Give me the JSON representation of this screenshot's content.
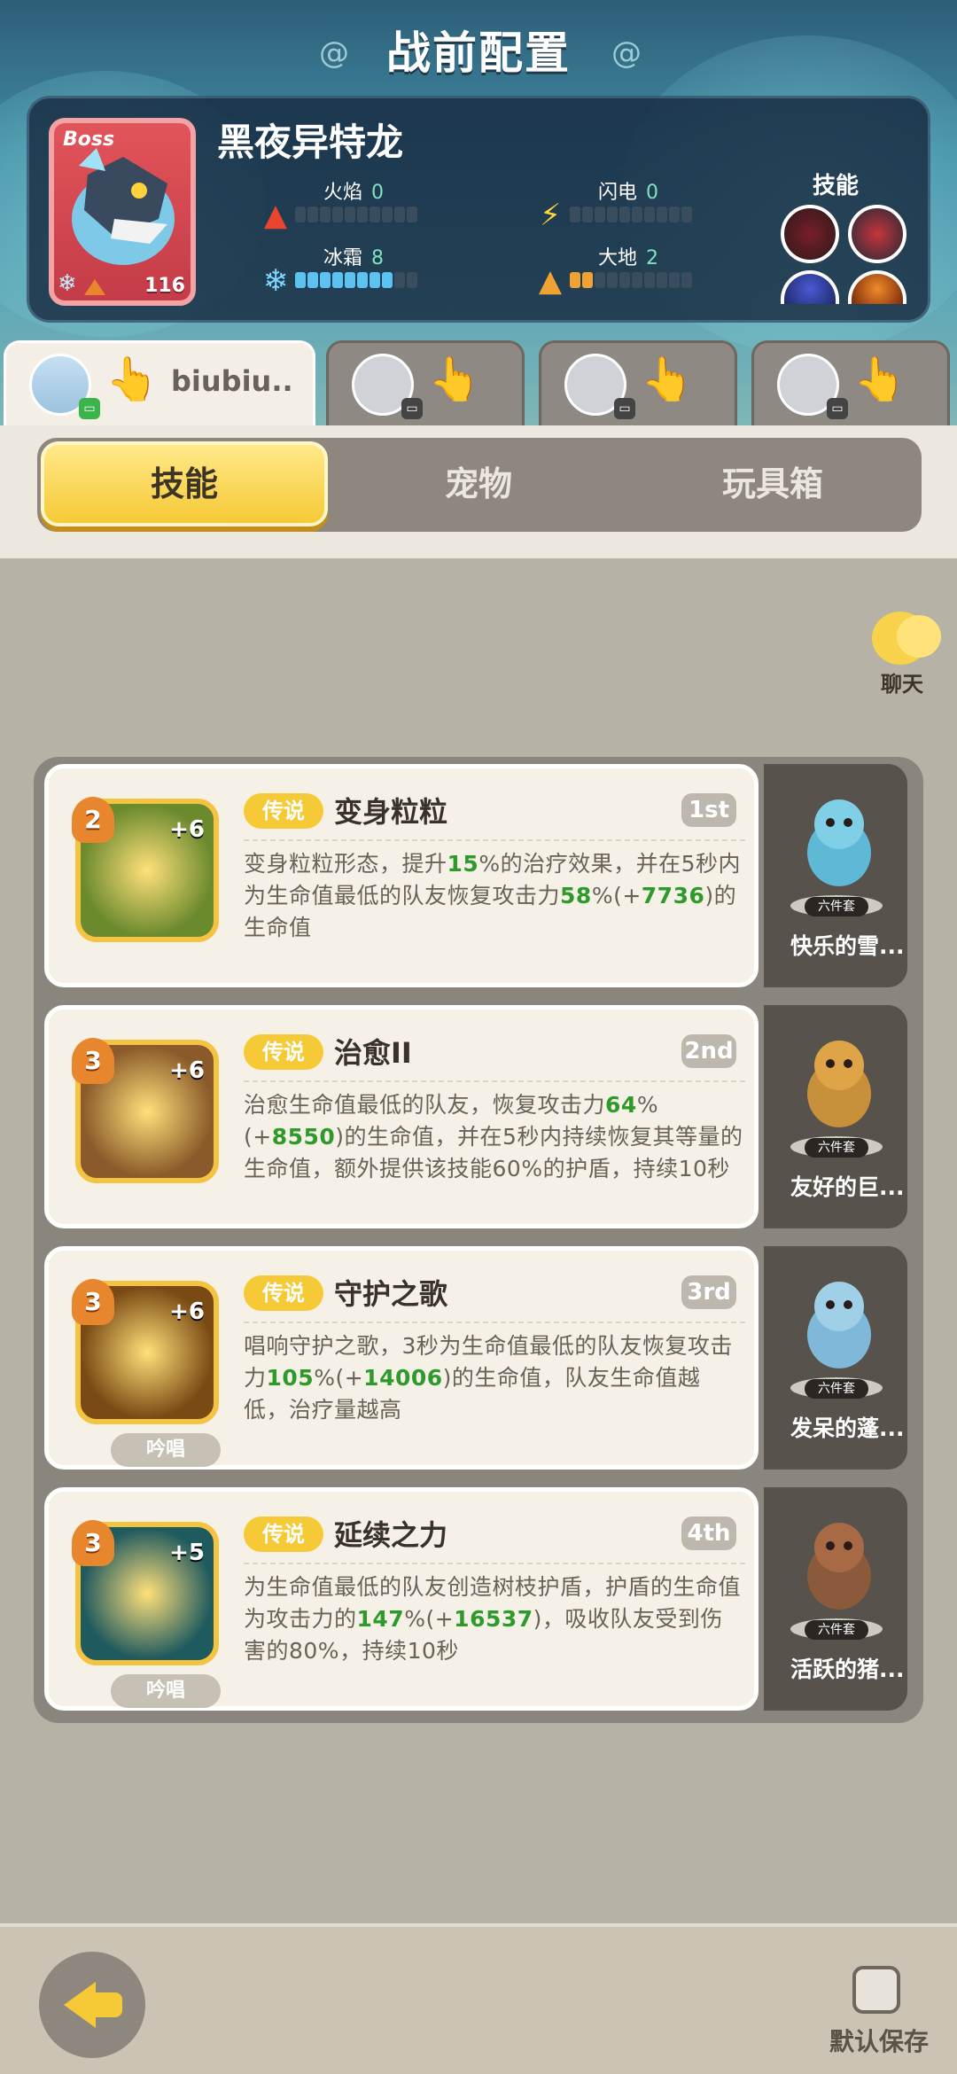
{
  "page_title": "战前配置",
  "boss": {
    "tag": "Boss",
    "name": "黑夜异特龙",
    "level": "116",
    "stats": [
      {
        "label": "火焰",
        "value": "0",
        "fill": 0,
        "kind": "fire"
      },
      {
        "label": "闪电",
        "value": "0",
        "fill": 0,
        "kind": "bolt"
      },
      {
        "label": "冰霜",
        "value": "8",
        "fill": 8,
        "kind": "ice"
      },
      {
        "label": "大地",
        "value": "2",
        "fill": 2,
        "kind": "earth"
      }
    ],
    "skills_label": "技能"
  },
  "players": [
    {
      "name": "biubiu..",
      "active": true
    },
    {
      "name": "",
      "active": false
    },
    {
      "name": "",
      "active": false
    },
    {
      "name": "",
      "active": false
    }
  ],
  "tabs": [
    {
      "label": "技能",
      "active": true
    },
    {
      "label": "宠物",
      "active": false
    },
    {
      "label": "玩具箱",
      "active": false
    }
  ],
  "chat_label": "聊天",
  "skills": [
    {
      "rarity": "传说",
      "name": "变身粒粒",
      "rank": "1st",
      "level": "2",
      "plus": "+6",
      "chant": "",
      "desc": [
        "变身粒粒形态，提升",
        "15",
        "%的治疗效果，并在5秒内为生命值最低的队友恢复攻击力",
        "58",
        "%(+",
        "7736",
        ")的生命值"
      ],
      "pet_name": "快乐的雪...",
      "pet_set": "六件套",
      "icon_color": "#6b8a2e"
    },
    {
      "rarity": "传说",
      "name": "治愈II",
      "rank": "2nd",
      "level": "3",
      "plus": "+6",
      "chant": "",
      "desc": [
        "治愈生命值最低的队友，恢复攻击力",
        "64",
        "%(+",
        "8550",
        ")的生命值，并在5秒内持续恢复其等量的生命值，额外提供该技能60%的护盾，持续10秒"
      ],
      "pet_name": "友好的巨...",
      "pet_set": "六件套",
      "icon_color": "#8a5a2a"
    },
    {
      "rarity": "传说",
      "name": "守护之歌",
      "rank": "3rd",
      "level": "3",
      "plus": "+6",
      "chant": "吟唱",
      "desc": [
        "唱响守护之歌，3秒为生命值最低的队友恢复攻击力",
        "105",
        "%(+",
        "14006",
        ")的生命值，队友生命值越低，治疗量越高"
      ],
      "pet_name": "发呆的蓬...",
      "pet_set": "六件套",
      "icon_color": "#7a4a14"
    },
    {
      "rarity": "传说",
      "name": "延续之力",
      "rank": "4th",
      "level": "3",
      "plus": "+5",
      "chant": "吟唱",
      "desc": [
        "为生命值最低的队友创造树枝护盾，护盾的生命值为攻击力的",
        "147",
        "%(+",
        "16537",
        ")，吸收队友受到伤害的80%，持续10秒"
      ],
      "pet_name": "活跃的猪...",
      "pet_set": "六件套",
      "icon_color": "#1f5a5e"
    }
  ],
  "bottom": {
    "save_label": "默认保存"
  }
}
